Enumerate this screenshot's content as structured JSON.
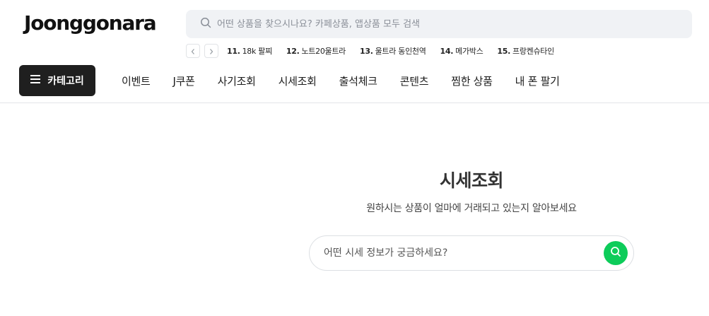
{
  "header": {
    "logo_text": "Joonggonara",
    "search_placeholder": "어떤 상품을 찾으시나요? 카페상품, 앱상품 모두 검색"
  },
  "popular_keywords": [
    {
      "rank": "11.",
      "keyword": "18k 팔찌"
    },
    {
      "rank": "12.",
      "keyword": "노트20울트라"
    },
    {
      "rank": "13.",
      "keyword": "울트라 동인천역"
    },
    {
      "rank": "14.",
      "keyword": "메가박스"
    },
    {
      "rank": "15.",
      "keyword": "프랑켄슈타인"
    }
  ],
  "nav": {
    "category_label": "카테고리",
    "items": [
      "이벤트",
      "J쿠폰",
      "사기조회",
      "시세조회",
      "출석체크",
      "콘텐츠",
      "찜한 상품",
      "내 폰 팔기"
    ]
  },
  "hero": {
    "title": "시세조회",
    "subtitle": "원하시는 상품이 얼마에 거래되고 있는지 알아보세요",
    "search_placeholder": "어떤 시세 정보가 궁금하세요?"
  },
  "colors": {
    "accent_green": "#0dcc5a",
    "category_button_bg": "#1f1f1f",
    "search_bg": "#f0f2f5"
  }
}
